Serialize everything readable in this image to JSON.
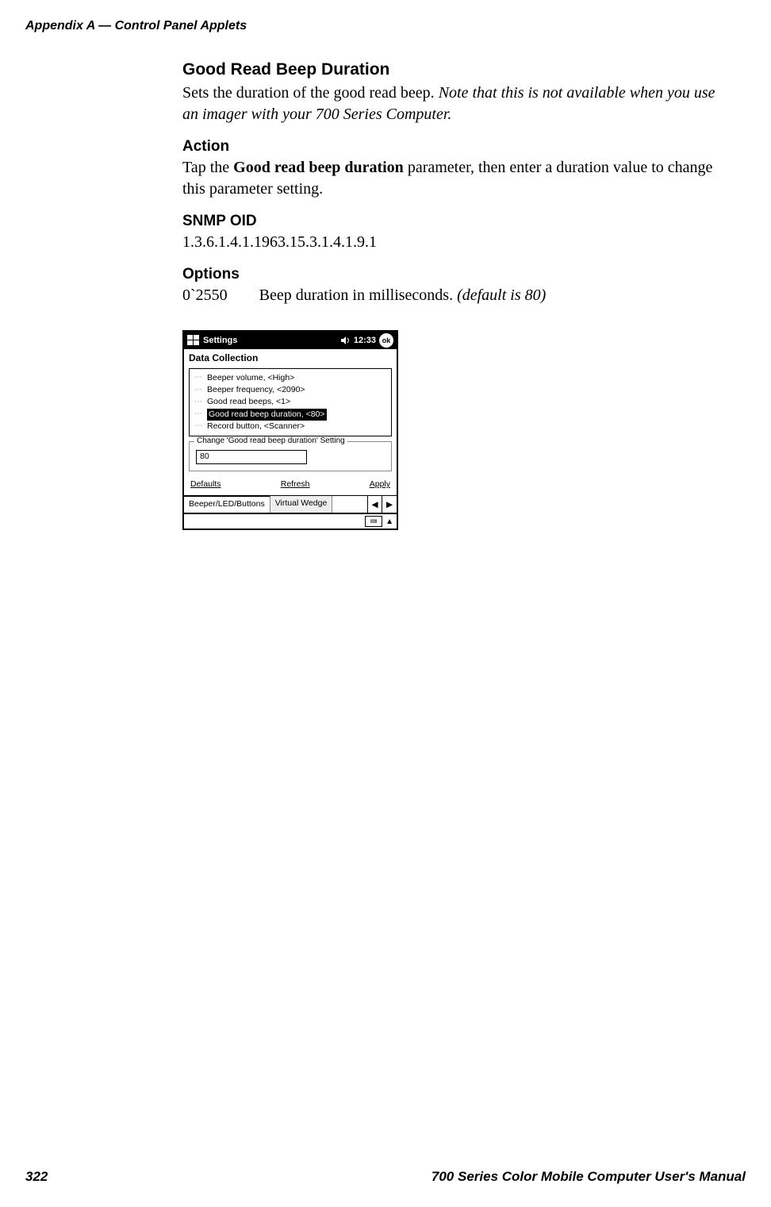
{
  "header": "Appendix  A    —   Control Panel Applets",
  "section": {
    "title": "Good Read Beep Duration",
    "para_start": "Sets the duration of the good read beep. ",
    "para_italic": "Note that this is not available when you use an imager with your 700 Series Computer."
  },
  "action": {
    "title": "Action",
    "pre": "Tap the ",
    "bold": "Good read beep duration",
    "post": " parameter, then enter a duration value to change this parameter setting."
  },
  "snmp": {
    "title": "SNMP OID",
    "oid": "1.3.6.1.4.1.1963.15.3.1.4.1.9.1"
  },
  "options": {
    "title": "Options",
    "range": "0`2550",
    "desc_plain": "Beep duration in milliseconds. ",
    "desc_italic": "(default is 80)"
  },
  "screenshot": {
    "topbar": {
      "title": "Settings",
      "time": "12:33",
      "ok": "ok"
    },
    "app_title": "Data Collection",
    "tree": [
      {
        "label": "Beeper volume, <High>",
        "selected": false
      },
      {
        "label": "Beeper frequency, <2090>",
        "selected": false
      },
      {
        "label": "Good read beeps, <1>",
        "selected": false
      },
      {
        "label": "Good read beep duration, <80>",
        "selected": true
      },
      {
        "label": "Record button, <Scanner>",
        "selected": false
      }
    ],
    "change_group": {
      "legend": "Change 'Good read beep duration' Setting",
      "value": "80"
    },
    "buttons": {
      "defaults": "Defaults",
      "refresh": "Refresh",
      "apply": "Apply"
    },
    "tabs": {
      "tab1": "Beeper/LED/Buttons",
      "tab2": "Virtual Wedge"
    }
  },
  "footer": {
    "page": "322",
    "manual": "700 Series Color Mobile Computer User's Manual"
  }
}
